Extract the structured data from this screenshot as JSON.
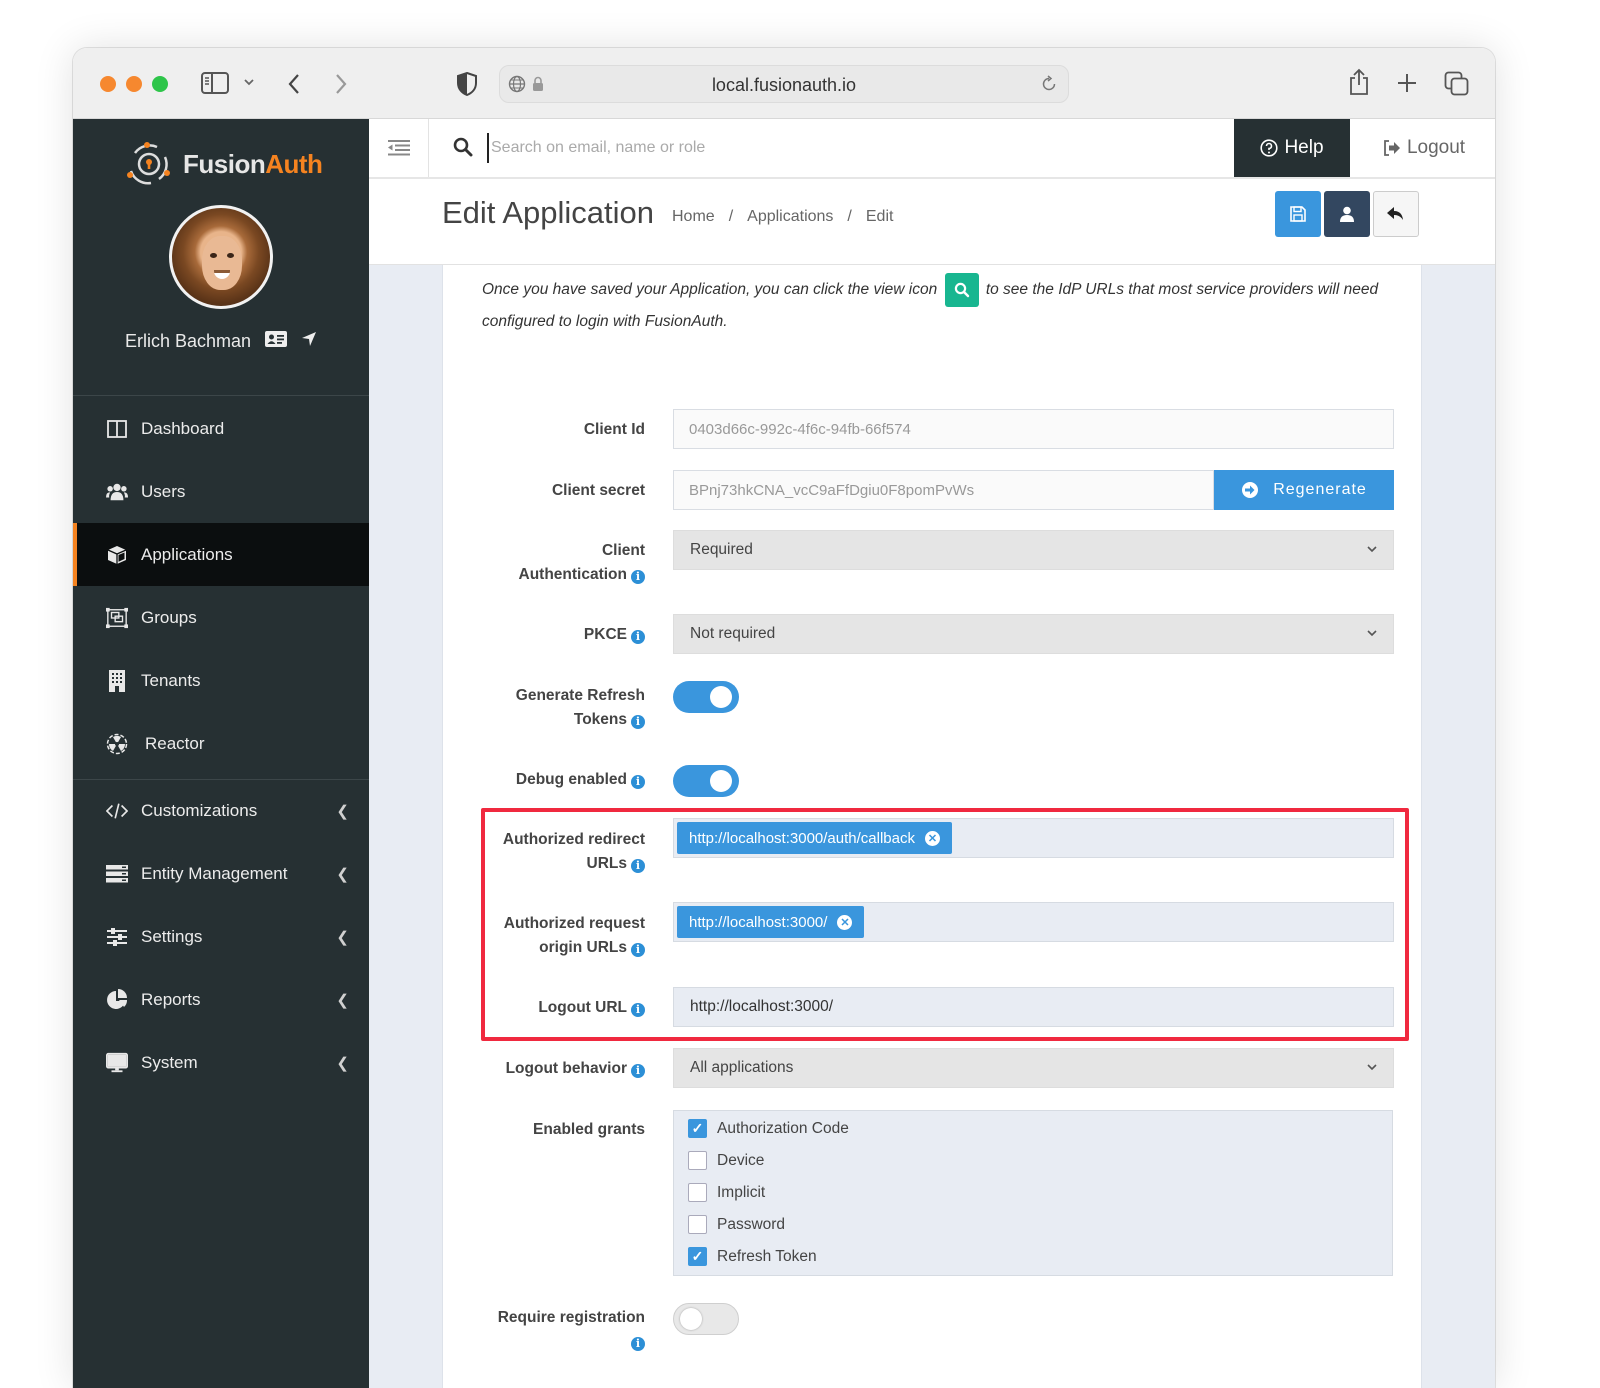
{
  "browser": {
    "url": "local.fusionauth.io"
  },
  "sidebar": {
    "brand_first": "Fusion",
    "brand_second": "Auth",
    "user_name": "Erlich Bachman",
    "items": [
      {
        "label": "Dashboard",
        "icon": "dashboard-icon",
        "active": false,
        "expandable": false
      },
      {
        "label": "Users",
        "icon": "users-icon",
        "active": false,
        "expandable": false
      },
      {
        "label": "Applications",
        "icon": "cube-icon",
        "active": true,
        "expandable": false
      },
      {
        "label": "Groups",
        "icon": "groups-icon",
        "active": false,
        "expandable": false
      },
      {
        "label": "Tenants",
        "icon": "building-icon",
        "active": false,
        "expandable": false
      },
      {
        "label": "Reactor",
        "icon": "reactor-icon",
        "active": false,
        "expandable": false
      },
      {
        "label": "Customizations",
        "icon": "code-icon",
        "active": false,
        "expandable": true
      },
      {
        "label": "Entity Management",
        "icon": "server-icon",
        "active": false,
        "expandable": true
      },
      {
        "label": "Settings",
        "icon": "sliders-icon",
        "active": false,
        "expandable": true
      },
      {
        "label": "Reports",
        "icon": "pie-chart-icon",
        "active": false,
        "expandable": true
      },
      {
        "label": "System",
        "icon": "desktop-icon",
        "active": false,
        "expandable": true
      }
    ]
  },
  "topbar": {
    "search_placeholder": "Search on email, name or role",
    "help_label": "Help",
    "logout_label": "Logout"
  },
  "header": {
    "title": "Edit Application",
    "breadcrumb": [
      "Home",
      "Applications",
      "Edit"
    ],
    "separator": "/"
  },
  "form": {
    "intro_before": "Once you have saved your Application, you can click the view icon",
    "intro_after": "to see the IdP URLs that most service providers will need configured to login with FusionAuth.",
    "client_id": {
      "label": "Client Id",
      "value": "0403d66c-992c-4f6c-94fb-66f574"
    },
    "client_secret": {
      "label": "Client secret",
      "value": "BPnj73hkCNA_vcC9aFfDgiu0F8pomPvWs",
      "button": "Regenerate"
    },
    "client_auth": {
      "label_line1": "Client",
      "label_line2": "Authentication",
      "value": "Required"
    },
    "pkce": {
      "label": "PKCE",
      "value": "Not required"
    },
    "refresh_tokens": {
      "label_line1": "Generate Refresh",
      "label_line2": "Tokens",
      "enabled": true
    },
    "debug": {
      "label": "Debug enabled",
      "enabled": true
    },
    "redirect_urls": {
      "label_line1": "Authorized redirect",
      "label_line2": "URLs",
      "values": [
        "http://localhost:3000/auth/callback"
      ]
    },
    "origin_urls": {
      "label_line1": "Authorized request",
      "label_line2": "origin URLs",
      "values": [
        "http://localhost:3000/"
      ]
    },
    "logout_url": {
      "label": "Logout URL",
      "value": "http://localhost:3000/"
    },
    "logout_behavior": {
      "label": "Logout behavior",
      "value": "All applications"
    },
    "grants": {
      "label": "Enabled grants",
      "items": [
        {
          "label": "Authorization Code",
          "checked": true
        },
        {
          "label": "Device",
          "checked": false
        },
        {
          "label": "Implicit",
          "checked": false
        },
        {
          "label": "Password",
          "checked": false
        },
        {
          "label": "Refresh Token",
          "checked": true
        }
      ]
    },
    "require_registration": {
      "label": "Require registration",
      "enabled": false
    }
  },
  "colors": {
    "accent": "#3a96dd",
    "brand_orange": "#f58320",
    "sidebar_bg": "#263033",
    "highlight": "#f0293f",
    "view_icon": "#18b690"
  }
}
